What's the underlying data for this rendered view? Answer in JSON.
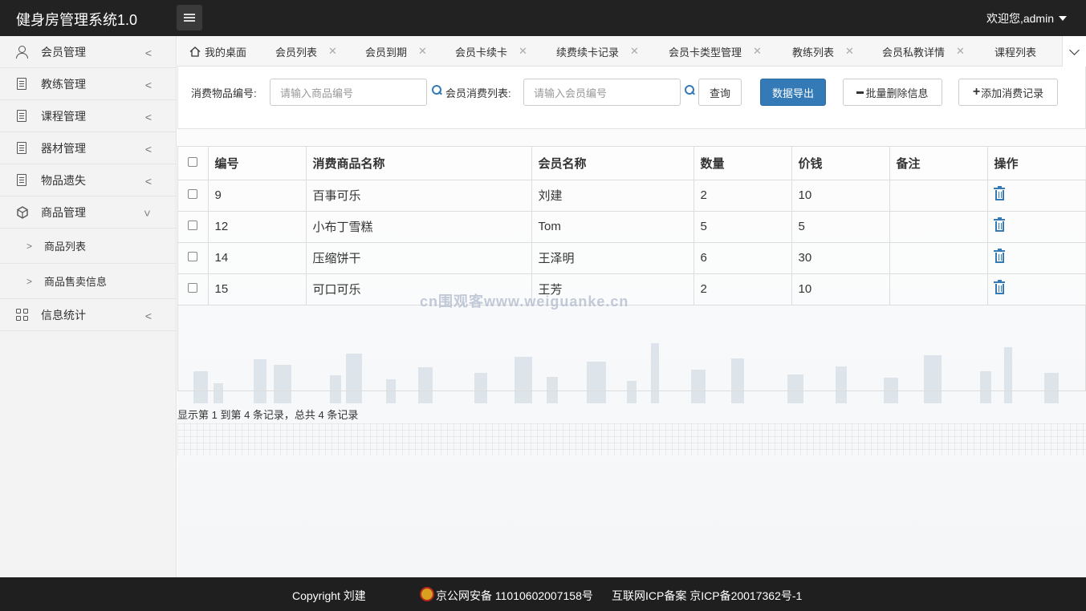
{
  "header": {
    "title": "健身房管理系统1.0",
    "welcome": "欢迎您,admin"
  },
  "sidebar": {
    "items": [
      {
        "label": "会员管理",
        "icon": "user-icon"
      },
      {
        "label": "教练管理",
        "icon": "document-icon"
      },
      {
        "label": "课程管理",
        "icon": "document-icon"
      },
      {
        "label": "器材管理",
        "icon": "document-icon"
      },
      {
        "label": "物品遗失",
        "icon": "document-icon"
      },
      {
        "label": "商品管理",
        "icon": "box-icon",
        "expanded": true,
        "children": [
          "商品列表",
          "商品售卖信息"
        ]
      },
      {
        "label": "信息统计",
        "icon": "grid-icon"
      }
    ]
  },
  "tabs": [
    {
      "label": "我的桌面",
      "closable": false
    },
    {
      "label": "会员列表",
      "closable": true
    },
    {
      "label": "会员到期",
      "closable": true
    },
    {
      "label": "会员卡续卡",
      "closable": true
    },
    {
      "label": "续费续卡记录",
      "closable": true
    },
    {
      "label": "会员卡类型管理",
      "closable": true
    },
    {
      "label": "教练列表",
      "closable": true
    },
    {
      "label": "会员私教详情",
      "closable": true
    },
    {
      "label": "课程列表",
      "closable": false
    }
  ],
  "search": {
    "goods_label": "消费物品编号:",
    "goods_placeholder": "请输入商品编号",
    "member_label": "会员消费列表:",
    "member_placeholder": "请输入会员编号",
    "query_btn": "查询",
    "export_btn": "数据导出",
    "batch_delete_btn": "批量删除信息",
    "add_btn": "添加消费记录"
  },
  "table": {
    "columns": [
      "编号",
      "消费商品名称",
      "会员名称",
      "数量",
      "价钱",
      "备注",
      "操作"
    ],
    "rows": [
      {
        "id": "9",
        "goods": "百事可乐",
        "member": "刘建",
        "qty": "2",
        "price": "10",
        "note": ""
      },
      {
        "id": "12",
        "goods": "小布丁雪糕",
        "member": "Tom",
        "qty": "5",
        "price": "5",
        "note": ""
      },
      {
        "id": "14",
        "goods": "压缩饼干",
        "member": "王泽明",
        "qty": "6",
        "price": "30",
        "note": ""
      },
      {
        "id": "15",
        "goods": "可口可乐",
        "member": "王芳",
        "qty": "2",
        "price": "10",
        "note": ""
      }
    ]
  },
  "watermark": "cn围观客www.weiguanke.cn",
  "pager": "显示第 1 到第 4 条记录，总共 4 条记录",
  "footer": {
    "copyright": "Copyright 刘建",
    "police": "京公网安备 11010602007158号",
    "icp": "互联网ICP备案 京ICP备20017362号-1"
  },
  "colors": {
    "header_bg": "#222222",
    "primary": "#337ab7",
    "footer_bg": "#1f1f1f"
  }
}
